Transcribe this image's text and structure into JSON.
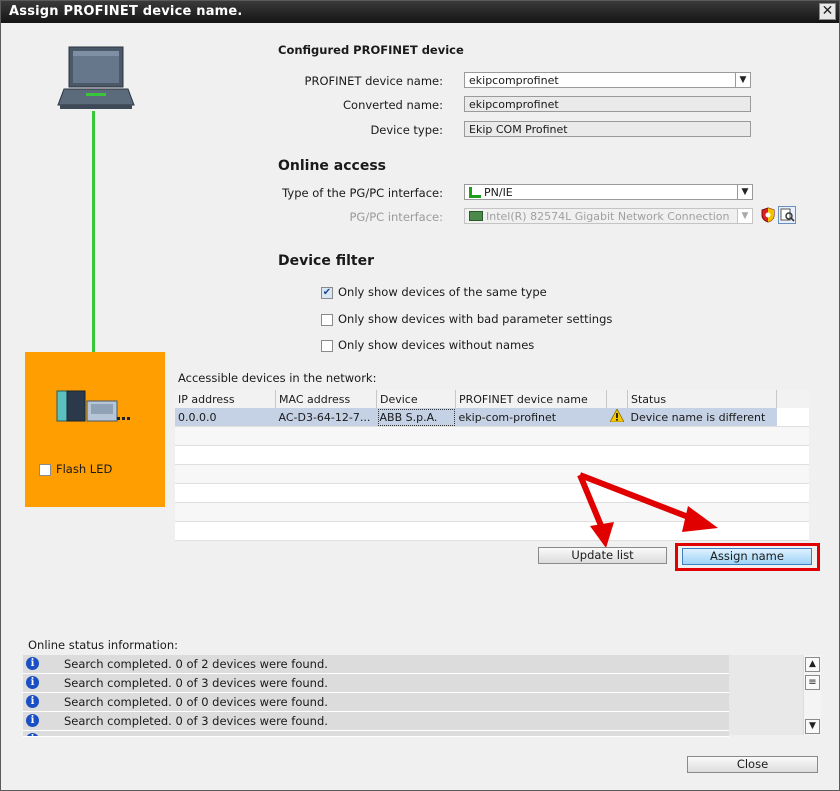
{
  "window": {
    "title": "Assign PROFINET device name.",
    "close_glyph": "✕"
  },
  "configured": {
    "heading": "Configured PROFINET device",
    "device_name_label": "PROFINET device name:",
    "device_name_value": "ekipcomprofinet",
    "converted_name_label": "Converted name:",
    "converted_name_value": "ekipcomprofinet",
    "device_type_label": "Device type:",
    "device_type_value": "Ekip COM Profinet"
  },
  "online_access": {
    "heading": "Online access",
    "interface_type_label": "Type of the PG/PC interface:",
    "interface_type_value": "PN/IE",
    "pgpc_interface_label": "PG/PC interface:",
    "pgpc_interface_value": "Intel(R) 82574L Gigabit Network Connection"
  },
  "device_filter": {
    "heading": "Device filter",
    "options": [
      {
        "label": "Only show devices of the same type",
        "checked": true
      },
      {
        "label": "Only show devices with bad parameter settings",
        "checked": false
      },
      {
        "label": "Only show devices without names",
        "checked": false
      }
    ]
  },
  "device_panel": {
    "flash_led_label": "Flash LED",
    "flash_led_checked": false
  },
  "accessible": {
    "heading": "Accessible devices in the network:",
    "columns": [
      "IP address",
      "MAC address",
      "Device",
      "PROFINET device name",
      "",
      "Status"
    ],
    "rows": [
      {
        "ip": "0.0.0.0",
        "mac": "AC-D3-64-12-7...",
        "device": "ABB S.p.A.",
        "profinet_name": "ekip-com-profinet",
        "status": "Device name is different"
      }
    ]
  },
  "buttons": {
    "update_list": "Update list",
    "assign_name": "Assign name",
    "close": "Close"
  },
  "online_status": {
    "heading": "Online status information:",
    "rows": [
      {
        "text": "Search completed. 0 of 2 devices were found."
      },
      {
        "text": "Search completed. 0 of 3 devices were found."
      },
      {
        "text": "Search completed. 0 of 0 devices were found."
      },
      {
        "text": "Search completed. 0 of 3 devices were found."
      }
    ]
  },
  "colors": {
    "accent_red": "#e10000",
    "device_panel": "#ff9e00",
    "network_line": "#3ac63a",
    "selection": "#c5d1e4"
  },
  "icons": [
    "pc-icon",
    "device-module-icon",
    "network-interface-icon",
    "warning-icon",
    "info-icon",
    "diagnostics-icon",
    "properties-icon"
  ]
}
